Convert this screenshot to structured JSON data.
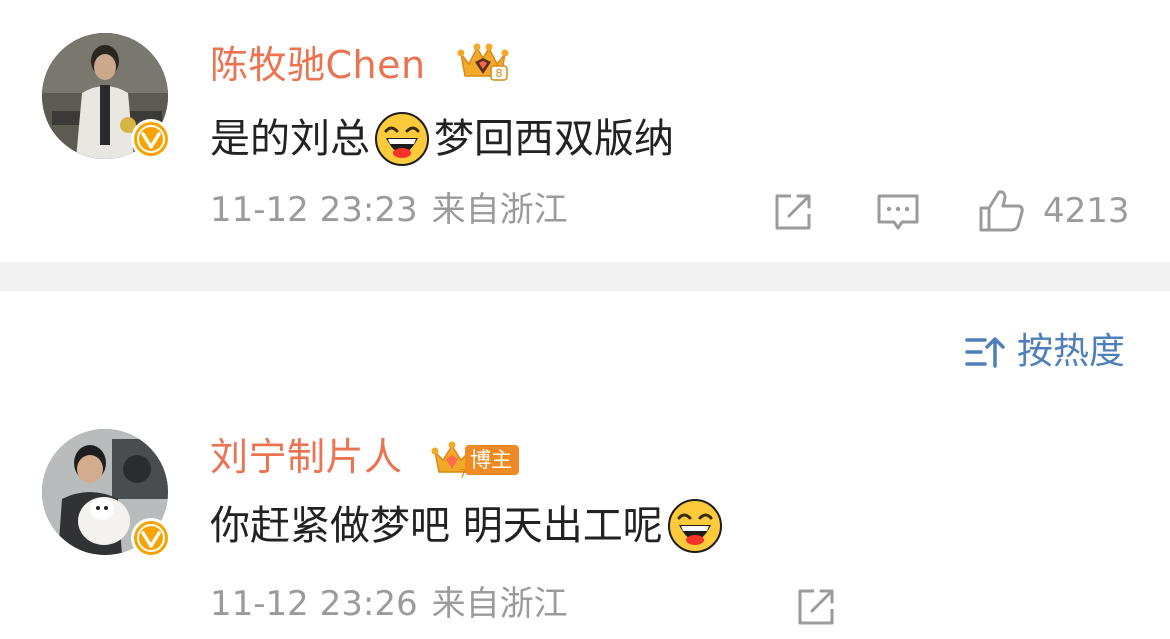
{
  "comments": [
    {
      "username": "陈牧驰Chen",
      "content_before": "是的刘总",
      "content_after": "梦回西双版纳",
      "timestamp": "11-12 23:23",
      "location": "来自浙江",
      "like_count": "4213",
      "badge_icon": "diamond-crown-badge",
      "verified_badge_color": "#f7a300"
    },
    {
      "username": "刘宁制片人",
      "blogger_tag": "博主",
      "content_before": "你赶紧做梦吧 明天出工呢",
      "timestamp": "11-12 23:26",
      "location": "来自浙江",
      "badge_icon": "crown-badge",
      "verified_badge_color": "#f7a300"
    }
  ],
  "sort": {
    "label": "按热度",
    "icon": "sort-icon"
  },
  "colors": {
    "username": "#eb7350",
    "link": "#4f7fbb",
    "meta": "#9b9b9b",
    "divider": "#f2f2f2"
  }
}
